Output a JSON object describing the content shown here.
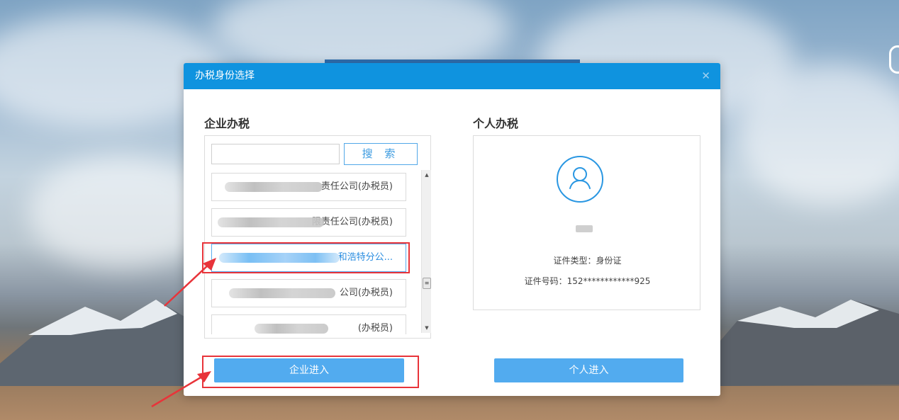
{
  "dialog": {
    "title": "办税身份选择",
    "close_icon": "close-icon"
  },
  "enterprise": {
    "section_title": "企业办税",
    "search_input_value": "",
    "search_button_label": "搜 索",
    "items": [
      {
        "label": "责任公司(办税员)"
      },
      {
        "label": "限责任公司(办税员)"
      },
      {
        "label": "和浩特分公..."
      },
      {
        "label": "公司(办税员)"
      },
      {
        "label": "(办税员)"
      }
    ],
    "selected_index": 2,
    "enter_button_label": "企业进入"
  },
  "personal": {
    "section_title": "个人办税",
    "avatar_icon": "user-avatar-icon",
    "id_type_label": "证件类型：身份证",
    "id_number_label": "证件号码：152************925",
    "enter_button_label": "个人进入"
  },
  "colors": {
    "header": "#0f93df",
    "button": "#52abef",
    "annotation": "#e8343a"
  }
}
